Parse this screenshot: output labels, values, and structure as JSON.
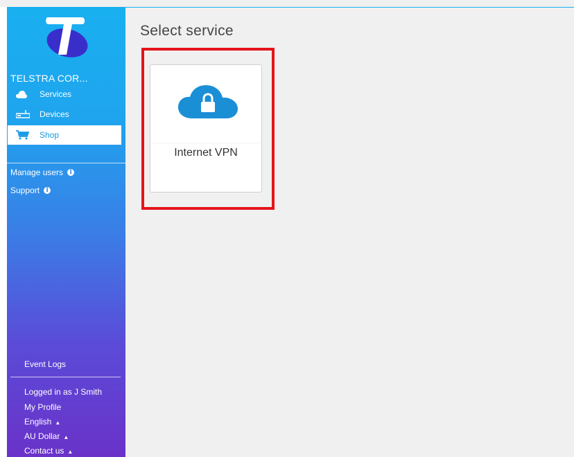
{
  "page_title": "Select service",
  "sidebar": {
    "company": "TELSTRA COR...",
    "nav": [
      {
        "label": "Services",
        "icon": "cloud-icon"
      },
      {
        "label": "Devices",
        "icon": "router-icon"
      },
      {
        "label": "Shop",
        "icon": "cart-icon"
      }
    ],
    "links": {
      "manage_users": "Manage users",
      "support": "Support"
    },
    "event_logs": "Event Logs",
    "bottom": {
      "logged_in": "Logged in as J Smith",
      "my_profile": "My Profile",
      "language": "English",
      "currency": "AU Dollar",
      "contact": "Contact us"
    }
  },
  "services": [
    {
      "label": "Internet VPN",
      "icon": "cloud-lock-icon"
    }
  ],
  "colors": {
    "accent": "#1a9be6",
    "highlight": "#e5141b",
    "logo": "#3a2ecb"
  }
}
